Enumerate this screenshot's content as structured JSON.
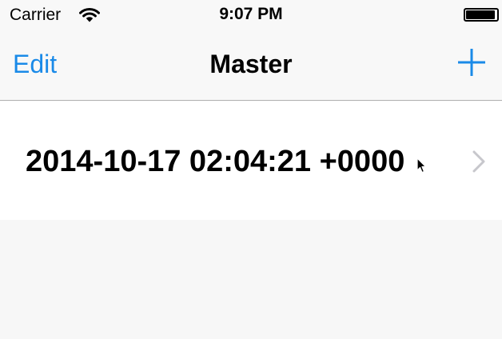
{
  "status_bar": {
    "carrier": "Carrier",
    "time": "9:07 PM",
    "battery_level": 0.95
  },
  "nav_bar": {
    "edit_label": "Edit",
    "title": "Master",
    "add_icon": "plus-icon"
  },
  "table": {
    "rows": [
      {
        "label": "2014-10-17 02:04:21 +0000"
      }
    ]
  },
  "colors": {
    "accent": "#1a8ae8",
    "background": "#f7f7f7",
    "bar_background": "#f8f8f8",
    "separator": "#b2b2b2",
    "chevron": "#c7c7cc"
  }
}
